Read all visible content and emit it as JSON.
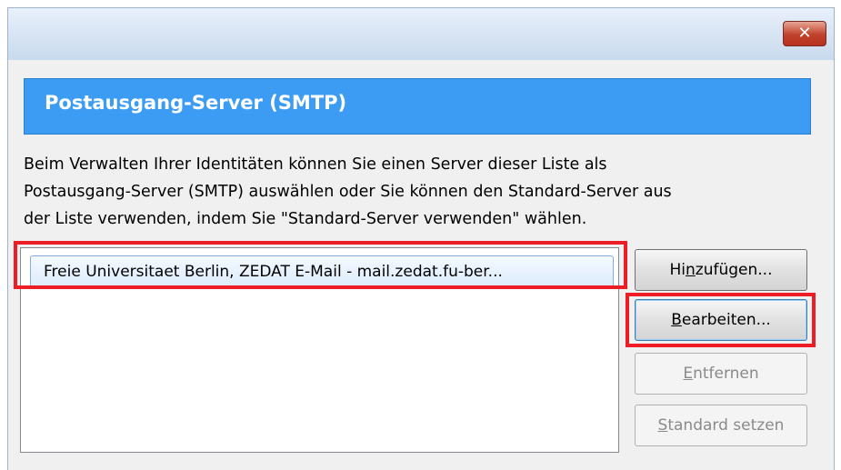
{
  "window": {
    "close_glyph": "✕"
  },
  "header": {
    "title": "Postausgang-Server (SMTP)"
  },
  "description": {
    "line1": "Beim Verwalten Ihrer Identitäten können Sie einen Server dieser Liste als",
    "line2": "Postausgang-Server (SMTP) auswählen oder Sie können den Standard-Server aus",
    "line3": "der Liste verwenden, indem Sie \"Standard-Server verwenden\" wählen."
  },
  "server_list": {
    "items": [
      {
        "label": "Freie Universitaet Berlin, ZEDAT E-Mail - mail.zedat.fu-ber...",
        "selected": true
      }
    ]
  },
  "buttons": {
    "add": {
      "pre": "Hi",
      "accel": "n",
      "post": "zufügen...",
      "enabled": true
    },
    "edit": {
      "pre": "",
      "accel": "B",
      "post": "earbeiten...",
      "enabled": true
    },
    "remove": {
      "pre": "",
      "accel": "E",
      "post": "ntfernen",
      "enabled": false
    },
    "set_default": {
      "pre": "",
      "accel": "S",
      "post": "tandard setzen",
      "enabled": false
    }
  },
  "colors": {
    "header_banner": "#3c9cf4",
    "highlight": "#ec1d24",
    "close_button": "#c0412c"
  },
  "icons": {
    "close": "close-icon"
  }
}
